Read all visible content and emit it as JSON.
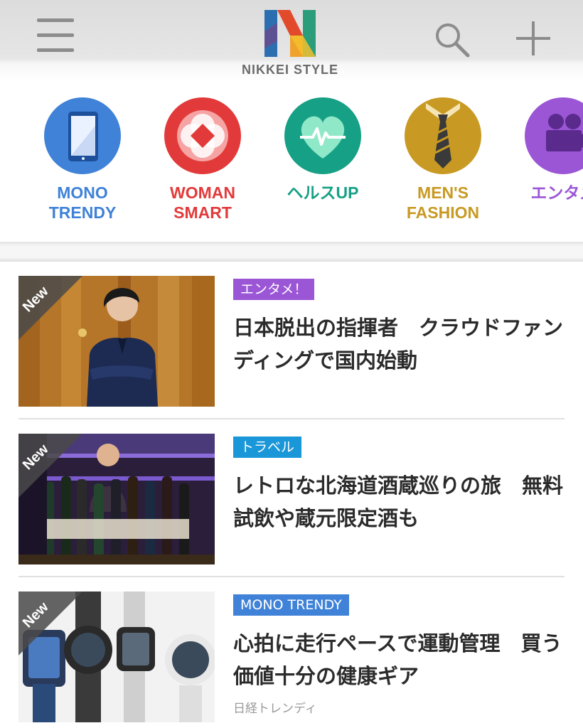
{
  "header": {
    "logo_text": "NIKKEI STYLE",
    "menu_icon": "hamburger-menu-icon",
    "search_icon": "search-icon",
    "add_icon": "plus-icon"
  },
  "categories": [
    {
      "label_line1": "MONO",
      "label_line2": "TRENDY",
      "color": "#3f82d8",
      "icon": "smartphone-icon"
    },
    {
      "label_line1": "WOMAN",
      "label_line2": "SMART",
      "color": "#e23a3a",
      "icon": "flower-icon"
    },
    {
      "label_line1": "ヘルスUP",
      "label_line2": "",
      "color": "#16a085",
      "icon": "heart-pulse-icon"
    },
    {
      "label_line1": "MEN'S",
      "label_line2": "FASHION",
      "color": "#c89a23",
      "icon": "necktie-icon"
    },
    {
      "label_line1": "エンタメ",
      "label_line2": "",
      "color": "#9b56d6",
      "icon": "projector-icon"
    }
  ],
  "articles": [
    {
      "badge": "New",
      "tag": "エンタメ！",
      "tag_color": "#9b56d6",
      "title": "日本脱出の指揮者　クラウドファンディングで国内始動",
      "source": ""
    },
    {
      "badge": "New",
      "tag": "トラベル",
      "tag_color": "#1a97d8",
      "title": "レトロな北海道酒蔵巡りの旅　無料試飲や蔵元限定酒も",
      "source": ""
    },
    {
      "badge": "New",
      "tag": "MONO TRENDY",
      "tag_color": "#3f82d8",
      "title": "心拍に走行ペースで運動管理　買う価値十分の健康ギア",
      "source": "日経トレンディ"
    }
  ]
}
